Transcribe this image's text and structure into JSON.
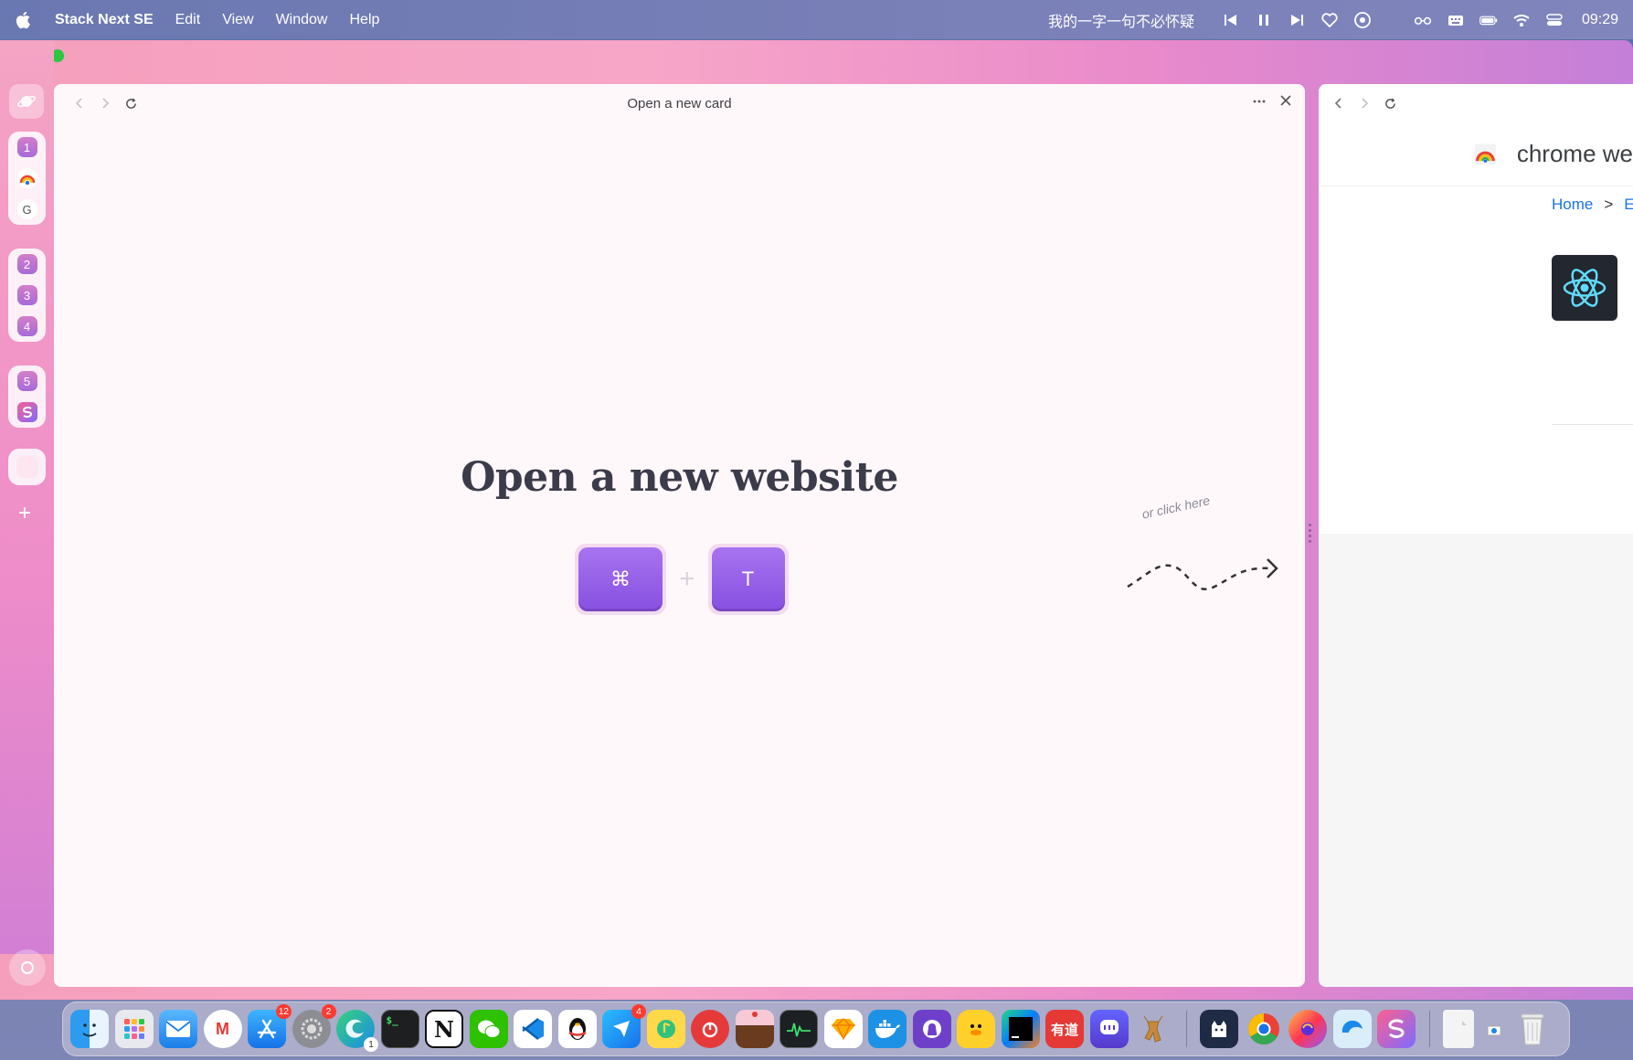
{
  "menubar": {
    "app_name": "Stack Next SE",
    "menus": [
      "Edit",
      "View",
      "Window",
      "Help"
    ],
    "now_playing": "我的一字一句不必怀疑",
    "clock": "09:29"
  },
  "sidebar": {
    "group1": [
      "1",
      "G"
    ],
    "group2": [
      "2",
      "3",
      "4"
    ],
    "group3": [
      "5"
    ]
  },
  "card": {
    "title": "Open a new card",
    "headline": "Open a new website",
    "key_cmd": "⌘",
    "key_plus": "+",
    "key_t": "T",
    "hint": "or click here"
  },
  "card2": {
    "store_title": "chrome we",
    "breadcrumb_home": "Home",
    "breadcrumb_sep": ">",
    "breadcrumb_next": "E"
  },
  "dock": {
    "badges": {
      "app_store": "12",
      "settings": "2",
      "edge": "1",
      "feishu": "4"
    },
    "youdao_label": "有道"
  },
  "colors": {
    "accent_key": "#8750e0",
    "window_pink": "#f7a6c8",
    "link_blue": "#1a73e8"
  }
}
